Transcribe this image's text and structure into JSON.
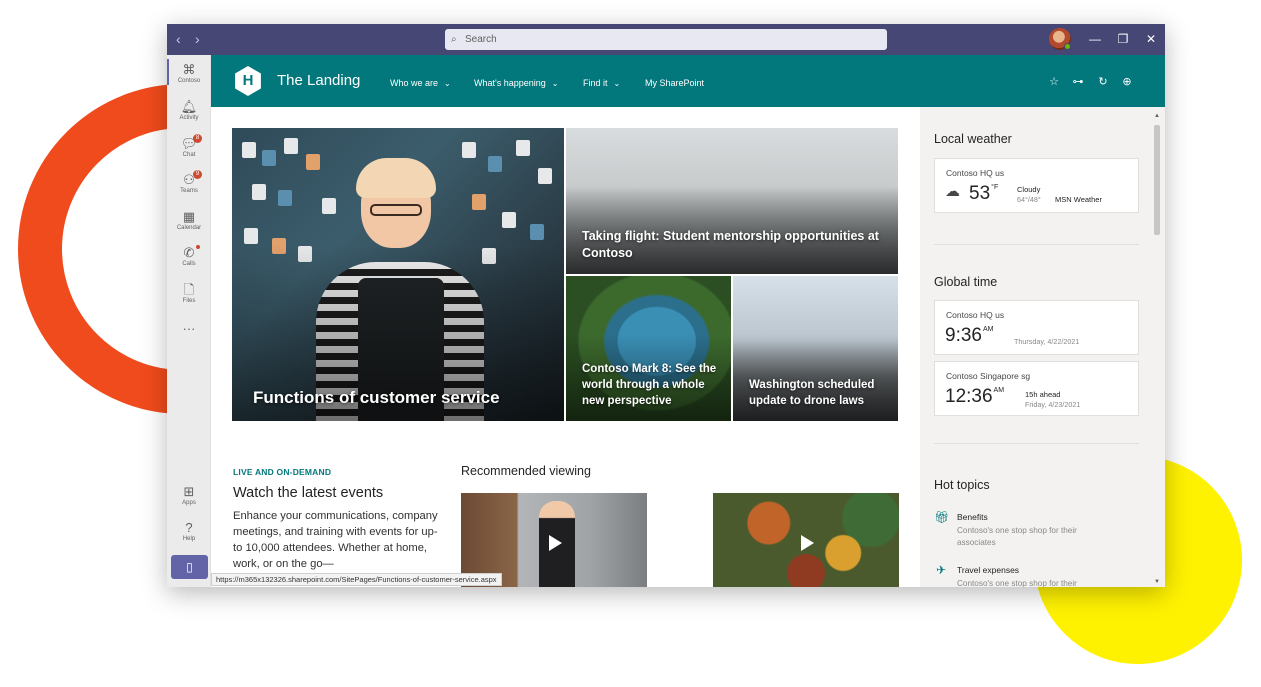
{
  "titlebar": {
    "search_placeholder": "Search",
    "back_glyph": "‹",
    "forward_glyph": "›",
    "minimize_glyph": "—",
    "restore_glyph": "❐",
    "close_glyph": "✕"
  },
  "rail": {
    "items": [
      {
        "label": "Contoso",
        "icon": "contoso-icon",
        "glyph": "⌘"
      },
      {
        "label": "Activity",
        "icon": "bell-icon",
        "glyph": "🔔︎"
      },
      {
        "label": "Chat",
        "icon": "chat-icon",
        "glyph": "💬︎",
        "badge": "8"
      },
      {
        "label": "Teams",
        "icon": "teams-icon",
        "glyph": "⚇",
        "badge": "9"
      },
      {
        "label": "Calendar",
        "icon": "calendar-icon",
        "glyph": "▦"
      },
      {
        "label": "Calls",
        "icon": "phone-icon",
        "glyph": "✆"
      },
      {
        "label": "Files",
        "icon": "file-icon",
        "glyph": "🗋"
      },
      {
        "label": "",
        "icon": "more-icon",
        "glyph": "···"
      },
      {
        "label": "Apps",
        "icon": "apps-icon",
        "glyph": "⊞"
      },
      {
        "label": "Help",
        "icon": "help-icon",
        "glyph": "?"
      }
    ],
    "mobile_glyph": "▯"
  },
  "sharepoint": {
    "logo_letter": "H",
    "site_title": "The Landing",
    "nav": [
      {
        "label": "Who we are",
        "has_menu": true
      },
      {
        "label": "What's happening",
        "has_menu": true
      },
      {
        "label": "Find it",
        "has_menu": true
      },
      {
        "label": "My SharePoint",
        "has_menu": false
      }
    ],
    "header_icons": [
      {
        "icon": "star-icon",
        "glyph": "☆"
      },
      {
        "icon": "link-icon",
        "glyph": "⊶"
      },
      {
        "icon": "refresh-icon",
        "glyph": "↻"
      },
      {
        "icon": "globe-icon",
        "glyph": "⊕"
      }
    ],
    "accent": "#03787c"
  },
  "hero": {
    "main": "Functions of customer service",
    "top": "Taking flight: Student mentorship opportunities at Contoso",
    "bottom_left": "Contoso Mark 8: See the world through a whole new perspective",
    "bottom_right": "Washington scheduled update to drone laws"
  },
  "events": {
    "tag": "LIVE AND ON-DEMAND",
    "title": "Watch the latest events",
    "body": "Enhance your communications, company meetings, and training with events for up-to 10,000 attendees. Whether at home, work, or on the go—"
  },
  "recommended": {
    "title": "Recommended viewing"
  },
  "status_url": "https://m365x132326.sharepoint.com/SitePages/Functions-of-customer-service.aspx",
  "weather": {
    "heading": "Local weather",
    "location": "Contoso HQ us",
    "temp": "53",
    "unit": "°F",
    "condition": "Cloudy",
    "range": "64°/48°",
    "source": "MSN Weather"
  },
  "global_time": {
    "heading": "Global time",
    "clocks": [
      {
        "location": "Contoso HQ us",
        "time": "9:36",
        "ampm": "AM",
        "offset": "",
        "date": "Thursday, 4/22/2021"
      },
      {
        "location": "Contoso Singapore sg",
        "time": "12:36",
        "ampm": "AM",
        "offset": "15h ahead",
        "date": "Friday, 4/23/2021"
      }
    ]
  },
  "hot_topics": {
    "heading": "Hot topics",
    "items": [
      {
        "name": "Benefits",
        "desc": "Contoso's one stop shop for their associates",
        "icon": "gift-icon",
        "glyph": "🎁︎"
      },
      {
        "name": "Travel expenses",
        "desc": "Contoso's one stop shop for their",
        "icon": "plane-icon",
        "glyph": "✈"
      }
    ]
  }
}
